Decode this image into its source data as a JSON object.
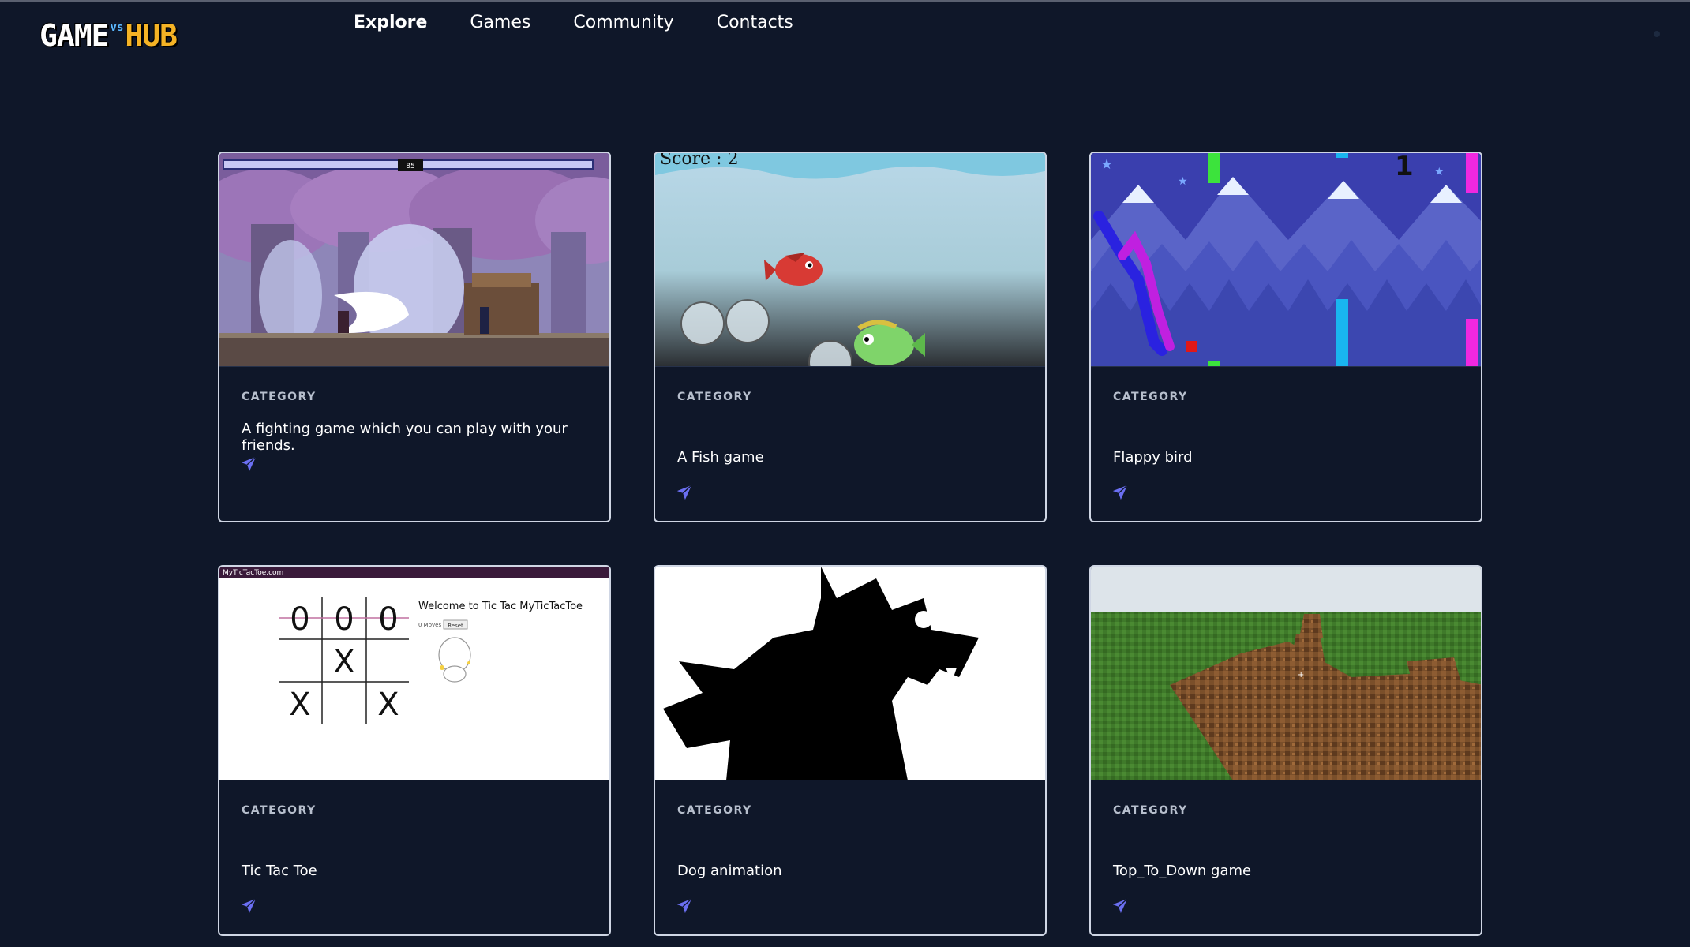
{
  "logo": {
    "part1": "GAME",
    "mid": "vs",
    "part2": "HUB"
  },
  "nav": [
    {
      "label": "Explore",
      "active": true
    },
    {
      "label": "Games",
      "active": false
    },
    {
      "label": "Community",
      "active": false
    },
    {
      "label": "Contacts",
      "active": false
    }
  ],
  "cards": [
    {
      "category": "CATEGORY",
      "title": "A fighting game which you can play with your friends.",
      "thumb": {
        "timer": "85"
      }
    },
    {
      "category": "CATEGORY",
      "title": "A Fish game",
      "thumb": {
        "score": "Score : 2"
      }
    },
    {
      "category": "CATEGORY",
      "title": "Flappy bird",
      "thumb": {
        "score": "1"
      }
    },
    {
      "category": "CATEGORY",
      "title": "Tic Tac Toe",
      "thumb": {
        "site": "MyTicTacToe.com",
        "heading": "Welcome to Tic Tac MyTicTacToe",
        "small_text": "0 Moves",
        "reset": "Reset",
        "board": [
          "0",
          "0",
          "0",
          "",
          "X",
          "",
          "X",
          "",
          "X"
        ]
      }
    },
    {
      "category": "CATEGORY",
      "title": "Dog animation",
      "thumb": {}
    },
    {
      "category": "CATEGORY",
      "title": "Top_To_Down game",
      "thumb": {}
    }
  ],
  "colors": {
    "background": "#0f1729",
    "accent": "#6b6ff2",
    "card_border": "#cfd6e4"
  },
  "icons": {
    "card_action": "send-icon"
  }
}
